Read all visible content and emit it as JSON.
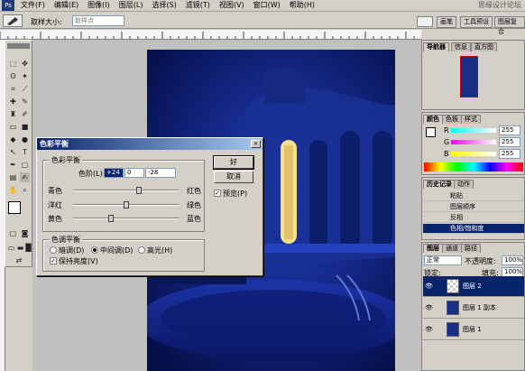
{
  "menu": [
    "文件(F)",
    "编辑(E)",
    "图像(I)",
    "图层(L)",
    "选择(S)",
    "滤镜(T)",
    "视图(V)",
    "窗口(W)",
    "帮助(H)"
  ],
  "watermark": "思缘设计论坛",
  "options": {
    "sample_label": "取样大小:",
    "sample_value": "取样点"
  },
  "right_tabs": [
    "画笔",
    "工具预设",
    "图层复合"
  ],
  "dialog": {
    "title": "色彩平衡",
    "group1_label": "色彩平衡",
    "levels_label": "色阶(L):",
    "levels": [
      "+24",
      "0",
      "-28"
    ],
    "rows": [
      {
        "left": "青色",
        "right": "红色",
        "value": 24
      },
      {
        "left": "洋红",
        "right": "绿色",
        "value": 0
      },
      {
        "left": "黄色",
        "right": "蓝色",
        "value": -28
      }
    ],
    "group2_label": "色调平衡",
    "tones": [
      "暗调(D)",
      "中间调(D)",
      "高光(H)"
    ],
    "tone_selected": 1,
    "preserve_label": "保持亮度(V)",
    "preserve_checked": true,
    "ok_label": "好",
    "cancel_label": "取消",
    "preview_label": "预览(P)",
    "preview_checked": true
  },
  "navigator": {
    "tabs": [
      "导航器",
      "信息",
      "直方图"
    ]
  },
  "color_panel": {
    "tabs": [
      "颜色",
      "色板",
      "样式"
    ],
    "channels": [
      {
        "label": "R",
        "value": "255",
        "color": "#e02020"
      },
      {
        "label": "G",
        "value": "255",
        "color": "#20b020"
      },
      {
        "label": "B",
        "value": "255",
        "color": "#2020e0"
      }
    ]
  },
  "history": {
    "tabs": [
      "历史记录",
      "动作"
    ],
    "items": [
      "粘贴",
      "图层顺序",
      "反相",
      "色相/饱和度"
    ],
    "selected": 3
  },
  "layers": {
    "tabs": [
      "图层",
      "通道",
      "路径"
    ],
    "blend_mode": "正常",
    "opacity_label": "不透明度:",
    "opacity": "100%",
    "lock_label": "锁定:",
    "fill_label": "填充:",
    "fill": "100%",
    "items": [
      "图层 2",
      "图层 1 副本",
      "图层 1"
    ],
    "selected": 0
  },
  "colors": {
    "foreground": "#ffffff",
    "background": "#e00000",
    "photo_deep": "#0b1a6e",
    "photo_mid": "#1c39b5",
    "window": "#f4e08c"
  }
}
